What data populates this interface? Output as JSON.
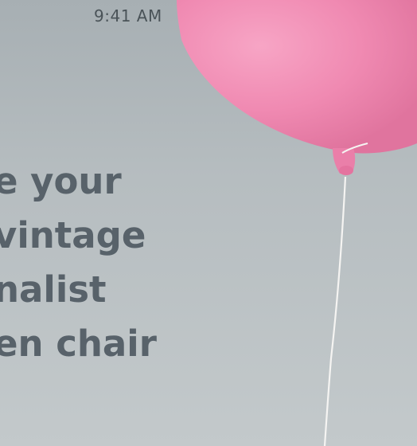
{
  "status_bar": {
    "time": "9:41 AM"
  },
  "headline": {
    "lines": [
      "e your",
      "vintage",
      "nalist",
      "en chair"
    ]
  },
  "colors": {
    "background": "#b6bdc0",
    "text": "#58626a",
    "balloon": "#f28bb4",
    "status": "#4a5358"
  },
  "icons": {
    "battery": "battery-icon",
    "balloon": "balloon-image"
  }
}
